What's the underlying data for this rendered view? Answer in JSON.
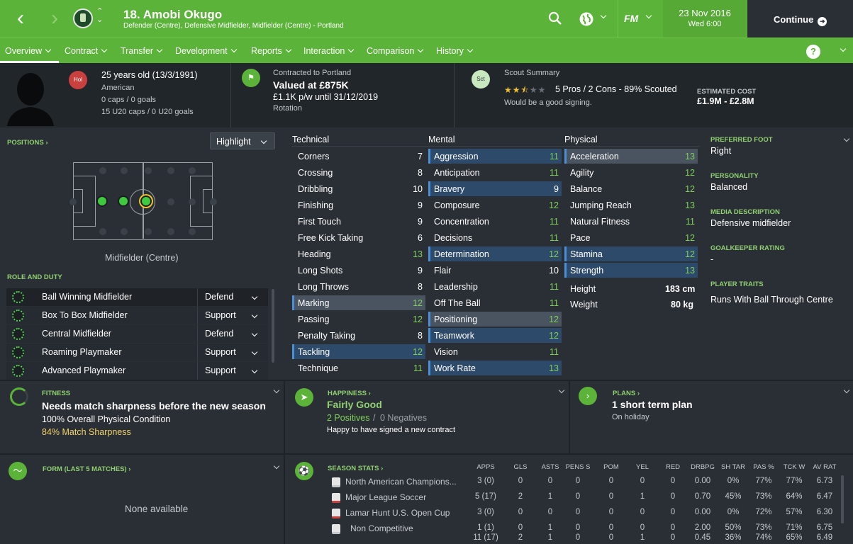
{
  "header": {
    "player_name": "18. Amobi Okugo",
    "player_sub": "Defender (Centre), Defensive Midfielder, Midfielder (Centre) - Portland",
    "date": "23 Nov 2016",
    "time": "Wed 6:00",
    "continue_label": "Continue",
    "fm_label": "FM"
  },
  "menu": [
    {
      "label": "Overview"
    },
    {
      "label": "Contract"
    },
    {
      "label": "Transfer"
    },
    {
      "label": "Development"
    },
    {
      "label": "Reports"
    },
    {
      "label": "Interaction"
    },
    {
      "label": "Comparison"
    },
    {
      "label": "History"
    }
  ],
  "help_label": "?",
  "info": {
    "nation_badge": "Hol",
    "age": "25 years old (13/3/1991)",
    "nationality": "American",
    "caps": "0 caps / 0 goals",
    "u20_caps": "15 U20 caps / 0 U20 goals",
    "contracted": "Contracted to Portland",
    "valued": "Valued at £875K",
    "wage": "£1.1K p/w until 31/12/2019",
    "status": "Rotation",
    "scout_badge": "Sct",
    "scout_title": "Scout Summary",
    "scout_rating": "2.5 of 5 stars",
    "scout_stats": "5 Pros / 2 Cons - 89% Scouted",
    "scout_note": "Would be a good signing.",
    "est_label": "ESTIMATED COST",
    "est_value": "£1.9M - £2.8M"
  },
  "positions": {
    "heading": "POSITIONS",
    "highlight_label": "Highlight",
    "position_label": "Midfielder (Centre)"
  },
  "roles": {
    "heading": "ROLE AND DUTY",
    "items": [
      {
        "name": "Ball Winning Midfielder",
        "duty": "Defend"
      },
      {
        "name": "Box To Box Midfielder",
        "duty": "Support"
      },
      {
        "name": "Central Midfielder",
        "duty": "Defend"
      },
      {
        "name": "Roaming Playmaker",
        "duty": "Support"
      },
      {
        "name": "Advanced Playmaker",
        "duty": "Support"
      }
    ]
  },
  "attributes": {
    "technical_heading": "Technical",
    "mental_heading": "Mental",
    "physical_heading": "Physical",
    "technical": [
      {
        "name": "Corners",
        "value": "7"
      },
      {
        "name": "Crossing",
        "value": "8"
      },
      {
        "name": "Dribbling",
        "value": "10"
      },
      {
        "name": "Finishing",
        "value": "9"
      },
      {
        "name": "First Touch",
        "value": "9"
      },
      {
        "name": "Free Kick Taking",
        "value": "6"
      },
      {
        "name": "Heading",
        "value": "13"
      },
      {
        "name": "Long Shots",
        "value": "9"
      },
      {
        "name": "Long Throws",
        "value": "8"
      },
      {
        "name": "Marking",
        "value": "12"
      },
      {
        "name": "Passing",
        "value": "12"
      },
      {
        "name": "Penalty Taking",
        "value": "8"
      },
      {
        "name": "Tackling",
        "value": "12"
      },
      {
        "name": "Technique",
        "value": "11"
      }
    ],
    "mental": [
      {
        "name": "Aggression",
        "value": "11"
      },
      {
        "name": "Anticipation",
        "value": "11"
      },
      {
        "name": "Bravery",
        "value": "9"
      },
      {
        "name": "Composure",
        "value": "12"
      },
      {
        "name": "Concentration",
        "value": "11"
      },
      {
        "name": "Decisions",
        "value": "11"
      },
      {
        "name": "Determination",
        "value": "12"
      },
      {
        "name": "Flair",
        "value": "10"
      },
      {
        "name": "Leadership",
        "value": "11"
      },
      {
        "name": "Off The Ball",
        "value": "11"
      },
      {
        "name": "Positioning",
        "value": "12"
      },
      {
        "name": "Teamwork",
        "value": "12"
      },
      {
        "name": "Vision",
        "value": "11"
      },
      {
        "name": "Work Rate",
        "value": "13"
      }
    ],
    "physical": [
      {
        "name": "Acceleration",
        "value": "13"
      },
      {
        "name": "Agility",
        "value": "12"
      },
      {
        "name": "Balance",
        "value": "12"
      },
      {
        "name": "Jumping Reach",
        "value": "13"
      },
      {
        "name": "Natural Fitness",
        "value": "11"
      },
      {
        "name": "Pace",
        "value": "12"
      },
      {
        "name": "Stamina",
        "value": "12"
      },
      {
        "name": "Strength",
        "value": "13"
      }
    ],
    "height_label": "Height",
    "height": "183 cm",
    "weight_label": "Weight",
    "weight": "80 kg"
  },
  "side": {
    "foot_h": "PREFERRED FOOT",
    "foot": "Right",
    "pers_h": "PERSONALITY",
    "pers": "Balanced",
    "media_h": "MEDIA DESCRIPTION",
    "media": "Defensive midfielder",
    "gk_h": "GOALKEEPER RATING",
    "gk": "-",
    "traits_h": "PLAYER TRAITS",
    "traits": "Runs With Ball Through Centre"
  },
  "fitness": {
    "heading": "FITNESS",
    "title": "Needs match sharpness before the new season",
    "condition": "100% Overall Physical Condition",
    "sharpness": "84% Match Sharpness"
  },
  "happiness": {
    "heading": "HAPPINESS",
    "title": "Fairly Good",
    "positives": "2 Positives",
    "sep": "/",
    "negatives": "0 Negatives",
    "note": "Happy to have signed a new contract"
  },
  "plans": {
    "heading": "PLANS",
    "title": "1 short term plan",
    "note": "On holiday"
  },
  "form": {
    "heading": "FORM (LAST 5 MATCHES)",
    "empty": "None available"
  },
  "season": {
    "heading": "SEASON STATS",
    "columns": [
      "APPS",
      "GLS",
      "ASTS",
      "PENS S",
      "POM",
      "YEL",
      "RED",
      "DRBPG",
      "SH TAR",
      "PAS %",
      "TCK W",
      "AV RAT"
    ],
    "rows": [
      {
        "name": "North American Champions...",
        "cells": [
          "3 (0)",
          "0",
          "0",
          "0",
          "0",
          "0",
          "0",
          "0.00",
          "0%",
          "77%",
          "77%",
          "6.73"
        ]
      },
      {
        "name": "Major League Soccer",
        "cells": [
          "5 (17)",
          "2",
          "1",
          "0",
          "0",
          "1",
          "0",
          "0.70",
          "45%",
          "73%",
          "64%",
          "6.47"
        ]
      },
      {
        "name": "Lamar Hunt U.S. Open Cup",
        "cells": [
          "3 (0)",
          "0",
          "0",
          "0",
          "0",
          "0",
          "0",
          "0.00",
          "0%",
          "72%",
          "57%",
          "6.30"
        ]
      },
      {
        "name": "Non Competitive",
        "cells": [
          "1 (1)",
          "0",
          "1",
          "0",
          "0",
          "0",
          "0",
          "2.00",
          "50%",
          "73%",
          "71%",
          "6.75"
        ]
      },
      {
        "name": "",
        "cells": [
          "11 (17)",
          "2",
          "1",
          "0",
          "0",
          "1",
          "0",
          "0.45",
          "36%",
          "74%",
          "65%",
          "6.49"
        ]
      }
    ]
  }
}
